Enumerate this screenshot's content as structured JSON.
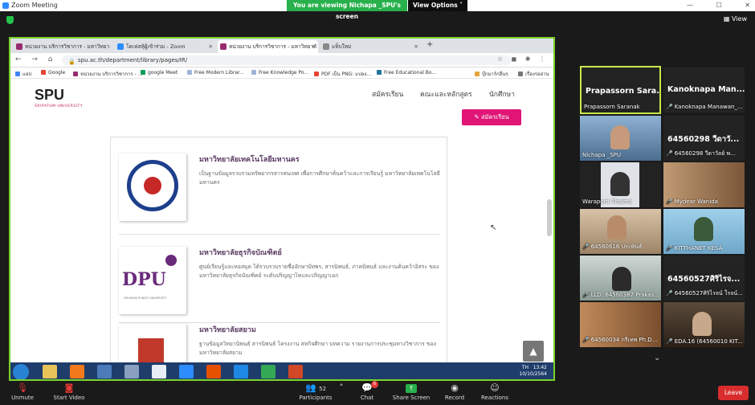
{
  "zoom": {
    "window_title": "Zoom Meeting",
    "viewing_banner": "You are viewing Nichapa _SPU's screen",
    "view_options": "View Options ˅",
    "view_button": "View"
  },
  "browser": {
    "tabs": [
      {
        "label": "หน่วยงาน บริการวิชาการ - มหาวิทยาลั"
      },
      {
        "label": "โดเฟสหุ้ผู้เข้าร่วม - Zoom"
      },
      {
        "label": "หน่วยงาน บริการวิชาการ - มหาวิทยาลั"
      },
      {
        "label": "แท็บใหม่"
      }
    ],
    "url": "spu.ac.th/department/library/pages/IR/",
    "bookmarks": [
      "แอป",
      "Google",
      "หน่วยงาน บริการวิชาการ - ...",
      "google Meet",
      "Free Modern Librar...",
      "Free Knowledge Po...",
      "PDF เป็น PNG: แปลง...",
      "Free Educational Bo...",
      "บุ๊กมาร์กอื่นๆ",
      "เรื่องรออ่าน"
    ]
  },
  "site": {
    "logo": "SPU",
    "logo_sub": "SRIPATUM UNIVERSITY",
    "nav": [
      "สมัครเรียน",
      "คณะและหลักสูตร",
      "นักศึกษา"
    ],
    "apply_button": "สมัครเรียน",
    "entries": [
      {
        "title": "มหาวิทยาลัยเทคโนโลยีมหานคร",
        "desc": "เป็นฐานข้อมูลรวบรวมทรัพยากรสารสนเทศ เพื่อการศึกษาค้นคว้าและการเรียนรู้ มหาวิทยาลัยเทคโนโลยีมหานคร"
      },
      {
        "title": "มหาวิทยาลัยธุรกิจบัณฑิตย์",
        "desc": "ศูนย์เรียนรู้และหอสมุด ได้รวบรวบรายชื่ออักษาบัทพร, สารนิพนธ์, ภาคนิพนธ์ และงานค้นคว้าอิสระ ของมหาวิทยาลัยธุรกิจบัณฑิตย์ ระดับปริญญาโทและปริญญาเอก",
        "logo_text": "DPU",
        "logo_sub": "DHURAKIJ PUNDIT UNIVERSITY"
      },
      {
        "title": "มหาวิทยาลัยสยาม",
        "desc": "ฐานข้อมูลวิทยานิพนธ์ สารนิพนธ์ โครงงาน สหกิจศึกษา บทความ รายงานการประชุมทางวิชาการ ของมหาวิทยาลัยสยาม"
      }
    ]
  },
  "taskbar": {
    "lang": "TH",
    "time": "13:42",
    "date": "10/10/2564"
  },
  "participants": [
    {
      "display": "Prapassorn Sara...",
      "label": "Prapassorn Saranak",
      "muted": false,
      "active": true
    },
    {
      "display": "Kanoknapa Man...",
      "label": "Kanoknapa Manawan_...",
      "muted": true
    },
    {
      "display": "",
      "label": "Nichapa _SPU",
      "muted": false
    },
    {
      "display": "64560298 วีดาวั...",
      "label": "64560298 วีดาวัลย์ พ...",
      "muted": true
    },
    {
      "display": "",
      "label": "Waraporn Thaima",
      "muted": false
    },
    {
      "display": "",
      "label": "Mydear Wanida",
      "muted": true
    },
    {
      "display": "",
      "label": "64560616 ประพันธ์",
      "muted": true
    },
    {
      "display": "",
      "label": "KITTHANET KESA",
      "muted": true
    },
    {
      "display": "",
      "label": "LLD. 64560387 Prakas...",
      "muted": true
    },
    {
      "display": "64560527ศิริไรจ...",
      "label": "64560527ศิริไรจน์ ใรจน์...",
      "muted": true
    },
    {
      "display": "",
      "label": "64560034 กรีเทพ Ph.D...",
      "muted": true
    },
    {
      "display": "",
      "label": "EDA.16 (64560010 KIT...",
      "muted": true
    }
  ],
  "toolbar": {
    "unmute": "Unmute",
    "start_video": "Start Video",
    "participants": "Participants",
    "participants_count": "52",
    "chat": "Chat",
    "chat_badge": "6",
    "share_screen": "Share Screen",
    "record": "Record",
    "reactions": "Reactions",
    "leave": "Leave"
  },
  "colors": {
    "zoom_green": "#27b04b",
    "active_border": "#c8e94a",
    "spu_pink": "#e01576",
    "leave_red": "#d92d2d"
  }
}
